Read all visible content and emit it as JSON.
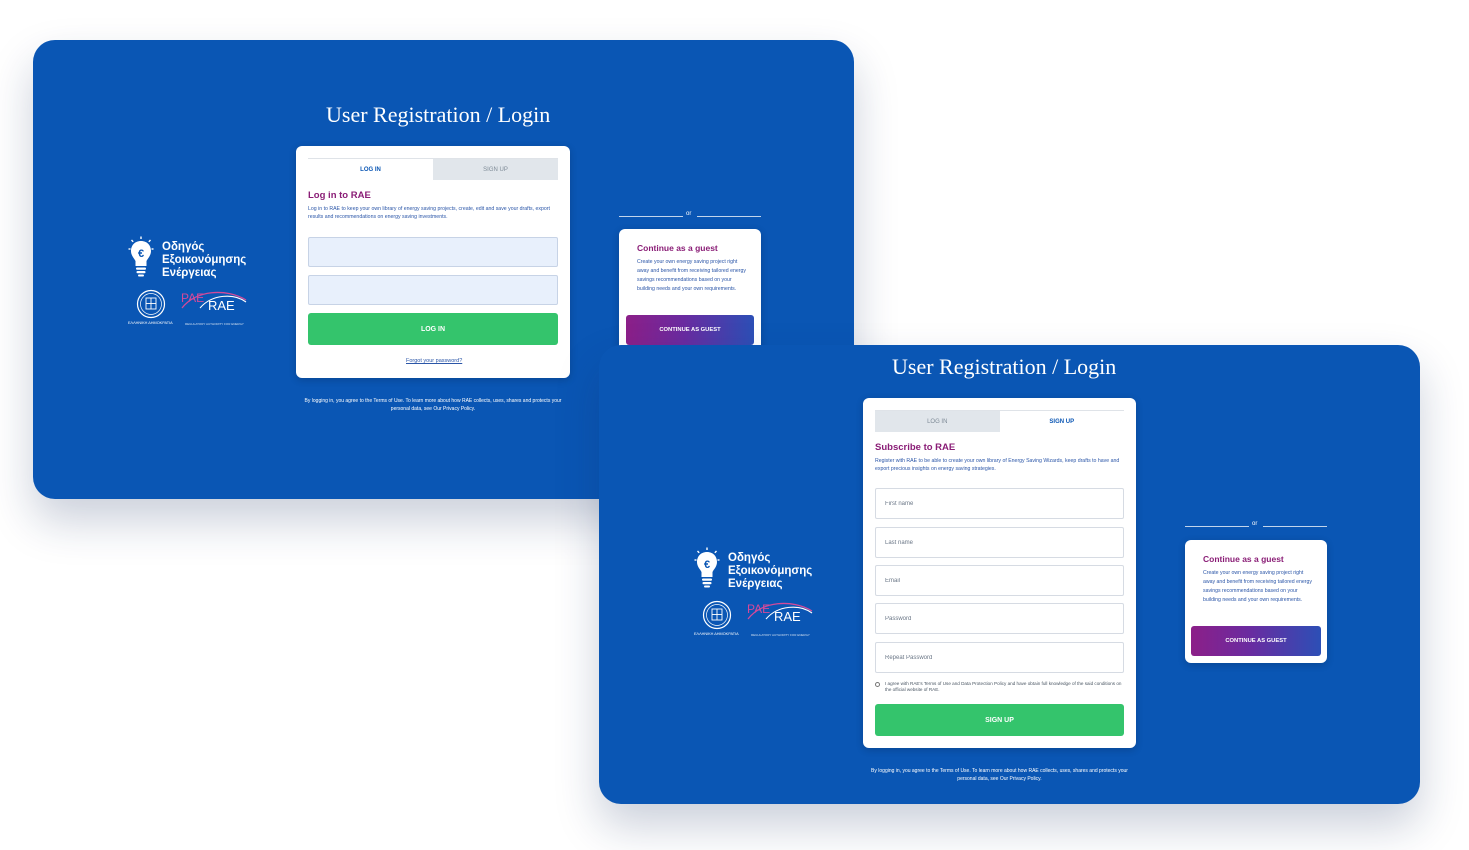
{
  "login_screen": {
    "page_title": "User Registration / Login",
    "tabs": [
      {
        "label": "LOG IN",
        "active": true
      },
      {
        "label": "SIGN UP",
        "active": false
      }
    ],
    "heading": "Log in to RAE",
    "description": "Log in to RAE to keep your own library of energy saving projects, create, edit and save your drafts, export results and recommendations on energy saving investments.",
    "fields": [
      {
        "placeholder": "",
        "value": ""
      },
      {
        "placeholder": "",
        "value": ""
      }
    ],
    "submit_label": "LOG IN",
    "forgot_link": "Forgot your password?",
    "footer": "By logging in, you agree to the Terms of Use. To learn more about how RAE collects, uses, shares and protects your personal data, see Our Privacy Policy.",
    "divider_or": "or",
    "guest": {
      "heading": "Continue as a guest",
      "description": "Create your own energy saving project right away and benefit from receiving tailored energy savings recommendations based on your building needs and your own requirements.",
      "button": "CONTINUE AS GUEST"
    },
    "logo": {
      "lines": [
        "Οδηγός",
        "Εξοικονόμησης",
        "Ενέργειας"
      ],
      "state_label": "ΕΛΛΗΝΙΚΗ ΔΗΜΟΚΡΑΤΙΑ",
      "rae_greek": "ΡΑΕ",
      "rae_latin": "RAE",
      "rae_caption": "REGULATORY AUTHORITY FOR ENERGY"
    }
  },
  "signup_screen": {
    "page_title": "User Registration / Login",
    "tabs": [
      {
        "label": "LOG IN",
        "active": false
      },
      {
        "label": "SIGN UP",
        "active": true
      }
    ],
    "heading": "Subscribe to RAE",
    "description": "Register with RAE to be able to create your own library of Energy Saving Wizards, keep drafts to have and export precious insights on energy saving strategies.",
    "fields": [
      {
        "placeholder": "First name"
      },
      {
        "placeholder": "Last name"
      },
      {
        "placeholder": "Email"
      },
      {
        "placeholder": "Password"
      },
      {
        "placeholder": "Repeat Password"
      }
    ],
    "terms_checked": false,
    "terms_text": "I agree with RAE's Terms of Use and Data Protection Policy and have obtain full knowledge of the said conditions on the official website of RAE.",
    "submit_label": "SIGN UP",
    "footer": "By logging in, you agree to the Terms of Use. To learn more about how RAE collects, uses, shares and protects your personal data, see Our Privacy Policy.",
    "divider_or": "or",
    "guest": {
      "heading": "Continue as a guest",
      "description": "Create your own energy saving project right away and benefit from receiving tailored energy savings recommendations based on your building needs and your own requirements.",
      "button": "CONTINUE AS GUEST"
    },
    "logo": {
      "lines": [
        "Οδηγός",
        "Εξοικονόμησης",
        "Ενέργειας"
      ],
      "state_label": "ΕΛΛΗΝΙΚΗ ΔΗΜΟΚΡΑΤΙΑ",
      "rae_greek": "ΡΑΕ",
      "rae_latin": "RAE",
      "rae_caption": "REGULATORY AUTHORITY FOR ENERGY"
    }
  },
  "colors": {
    "background": "#0a56b4",
    "accent_green": "#34c46c",
    "heading_purple": "#8a1d76",
    "guest_gradient_start": "#8c1f88",
    "guest_gradient_end": "#2c4fb6"
  }
}
